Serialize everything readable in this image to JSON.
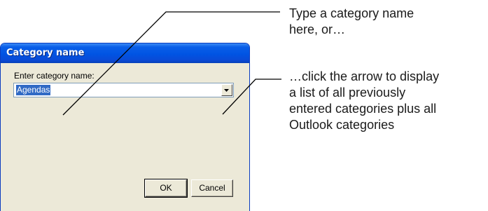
{
  "dialog": {
    "title": "Category name",
    "prompt": "Enter category name:",
    "combo_value": "Agendas",
    "ok_label": "OK",
    "cancel_label": "Cancel"
  },
  "callouts": {
    "first_line1": "Type a category name",
    "first_line2": "here, or…",
    "second_line1": "…click the arrow to display",
    "second_line2": "a list of all previously",
    "second_line3": "entered categories plus all",
    "second_line4": "Outlook categories"
  },
  "icons": [
    "dropdown-arrow-icon"
  ]
}
